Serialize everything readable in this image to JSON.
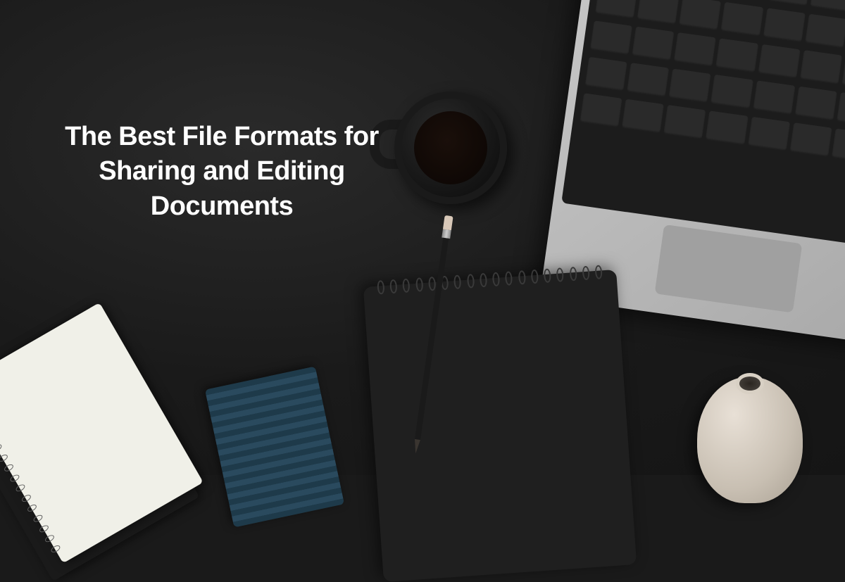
{
  "title": "The Best File Formats for Sharing and Editing Documents"
}
